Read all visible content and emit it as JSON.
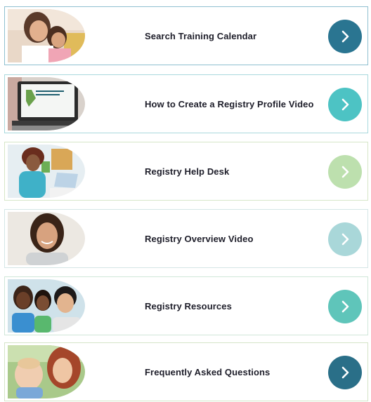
{
  "items": [
    {
      "label": "Search Training Calendar",
      "icon": "chevron-right-icon",
      "color": "#2a7591",
      "image": "mother-and-child-photo"
    },
    {
      "label": "How to Create a Registry Profile Video",
      "icon": "chevron-right-icon",
      "color": "#4dc3c4",
      "image": "laptop-video-photo"
    },
    {
      "label": "Registry Help Desk",
      "icon": "chevron-right-icon",
      "color": "#bde0ae",
      "image": "woman-at-laptop-photo"
    },
    {
      "label": "Registry Overview Video",
      "icon": "chevron-right-icon",
      "color": "#a9d7d9",
      "image": "smiling-woman-photo"
    },
    {
      "label": "Registry Resources",
      "icon": "chevron-right-icon",
      "color": "#5fc5ba",
      "image": "group-of-kids-photo"
    },
    {
      "label": "Frequently Asked Questions",
      "icon": "chevron-right-icon",
      "color": "#2a6f88",
      "image": "woman-and-baby-photo"
    }
  ]
}
